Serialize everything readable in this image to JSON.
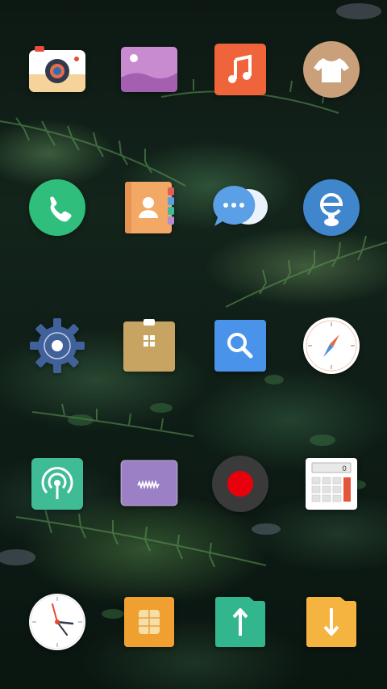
{
  "screen": {
    "type": "home-screen",
    "wallpaper": "fern-foliage"
  },
  "apps": [
    {
      "icon": "camera-icon",
      "colors": [
        "#ffffff",
        "#f6d39a",
        "#e74c3c",
        "#2f3b4c"
      ]
    },
    {
      "icon": "gallery-icon",
      "colors": [
        "#c98bd0",
        "#a55fb0",
        "#ffffff"
      ]
    },
    {
      "icon": "music-icon",
      "colors": [
        "#f0643c",
        "#ffffff"
      ]
    },
    {
      "icon": "t-shirt-icon",
      "colors": [
        "#c9a07a",
        "#ffffff"
      ]
    },
    {
      "icon": "phone-icon",
      "colors": [
        "#2fbe7b",
        "#ffffff"
      ]
    },
    {
      "icon": "contacts-icon",
      "colors": [
        "#f3a866",
        "#ffffff"
      ]
    },
    {
      "icon": "messages-icon",
      "colors": [
        "#5b9fe6",
        "#ffffff"
      ]
    },
    {
      "icon": "browser-icon",
      "colors": [
        "#3f86cc",
        "#ffffff"
      ]
    },
    {
      "icon": "settings-gear-icon",
      "colors": [
        "#41619b",
        "#ffffff"
      ]
    },
    {
      "icon": "file-manager-icon",
      "colors": [
        "#c8a463",
        "#ffffff"
      ]
    },
    {
      "icon": "search-icon",
      "colors": [
        "#4993ea",
        "#ffffff"
      ]
    },
    {
      "icon": "compass-icon",
      "colors": [
        "#ffffff",
        "#e46b4b",
        "#4a8fd8"
      ]
    },
    {
      "icon": "hotspot-icon",
      "colors": [
        "#3fbb95",
        "#ffffff"
      ]
    },
    {
      "icon": "voice-recorder-icon",
      "colors": [
        "#9b80c5",
        "#ffffff"
      ]
    },
    {
      "icon": "screen-record-icon",
      "colors": [
        "#3a3a3a",
        "#e8000c"
      ]
    },
    {
      "icon": "calculator-icon",
      "colors": [
        "#ffffff",
        "#e5553a",
        "#8a8a8a"
      ]
    },
    {
      "icon": "clock-icon",
      "colors": [
        "#ffffff",
        "#e64a2e",
        "#2f3b4c"
      ]
    },
    {
      "icon": "sim-card-icon",
      "colors": [
        "#f0a030",
        "#f7dfa4"
      ]
    },
    {
      "icon": "upload-icon",
      "colors": [
        "#33b68e",
        "#ffffff"
      ]
    },
    {
      "icon": "download-icon",
      "colors": [
        "#f5b33f",
        "#ffffff"
      ]
    }
  ]
}
